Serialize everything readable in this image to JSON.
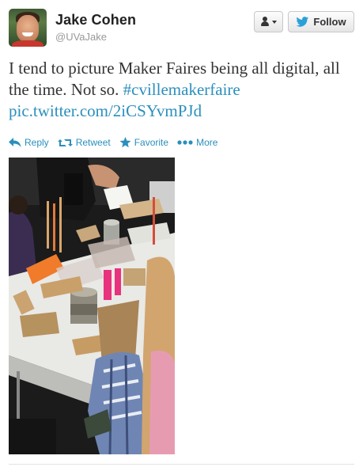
{
  "user": {
    "name": "Jake Cohen",
    "handle": "@UVaJake"
  },
  "header": {
    "follow_label": "Follow"
  },
  "tweet": {
    "text_part1": "I tend to picture Maker Faires being all digital, all the time. Not so. ",
    "hashtag": "#cvillemakerfaire",
    "pic_link": "pic.twitter.com/2iCSYvmPJd"
  },
  "actions": {
    "reply": "Reply",
    "retweet": "Retweet",
    "favorite": "Favorite",
    "more": "More"
  },
  "colors": {
    "link": "#2a8fbd",
    "name": "#222222",
    "handle": "#999999",
    "bird": "#2a9fd8"
  },
  "icons": [
    "user-icon",
    "twitter-bird-icon",
    "reply-icon",
    "retweet-icon",
    "star-icon",
    "more-icon"
  ]
}
